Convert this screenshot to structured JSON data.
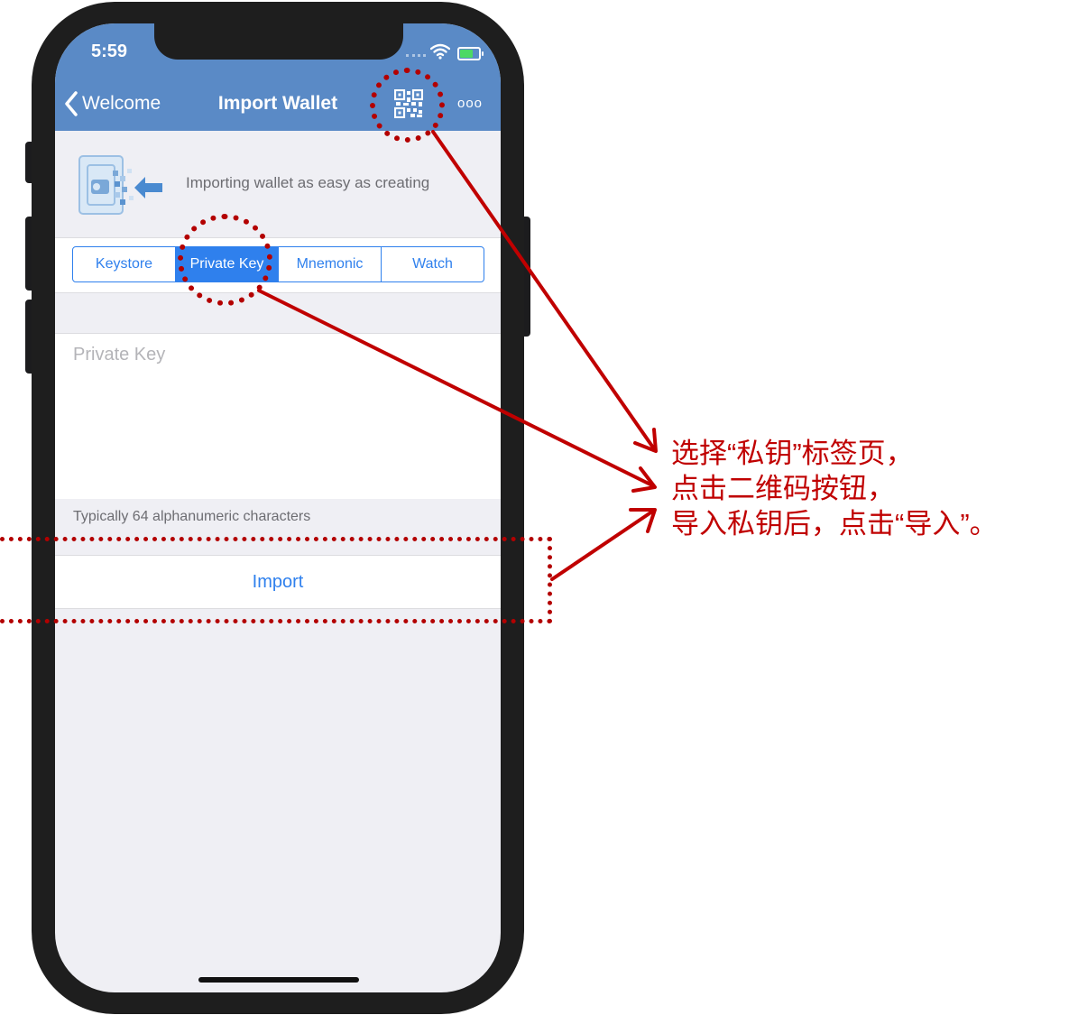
{
  "status_bar": {
    "time": "5:59"
  },
  "nav": {
    "back_label": "Welcome",
    "title": "Import Wallet",
    "more_label": "ooo"
  },
  "header": {
    "tagline": "Importing wallet as easy as creating"
  },
  "segments": [
    {
      "label": "Keystore",
      "active": false
    },
    {
      "label": "Private Key",
      "active": true
    },
    {
      "label": "Mnemonic",
      "active": false
    },
    {
      "label": "Watch",
      "active": false
    }
  ],
  "input": {
    "placeholder": "Private Key",
    "value": ""
  },
  "hint": "Typically 64 alphanumeric characters",
  "import_label": "Import",
  "annotation": {
    "lines": [
      "选择“私钥”标签页，",
      "点击二维码按钮，",
      "导入私钥后，点击“导入”。"
    ],
    "color": "#c00000"
  },
  "colors": {
    "nav_bar": "#5a8ac6",
    "accent": "#2f80ed",
    "background": "#efeff4"
  },
  "icons": [
    "chevron-left-icon",
    "qr-code-icon",
    "more-icon",
    "wifi-icon",
    "battery-icon",
    "import-wallet-illustration"
  ]
}
